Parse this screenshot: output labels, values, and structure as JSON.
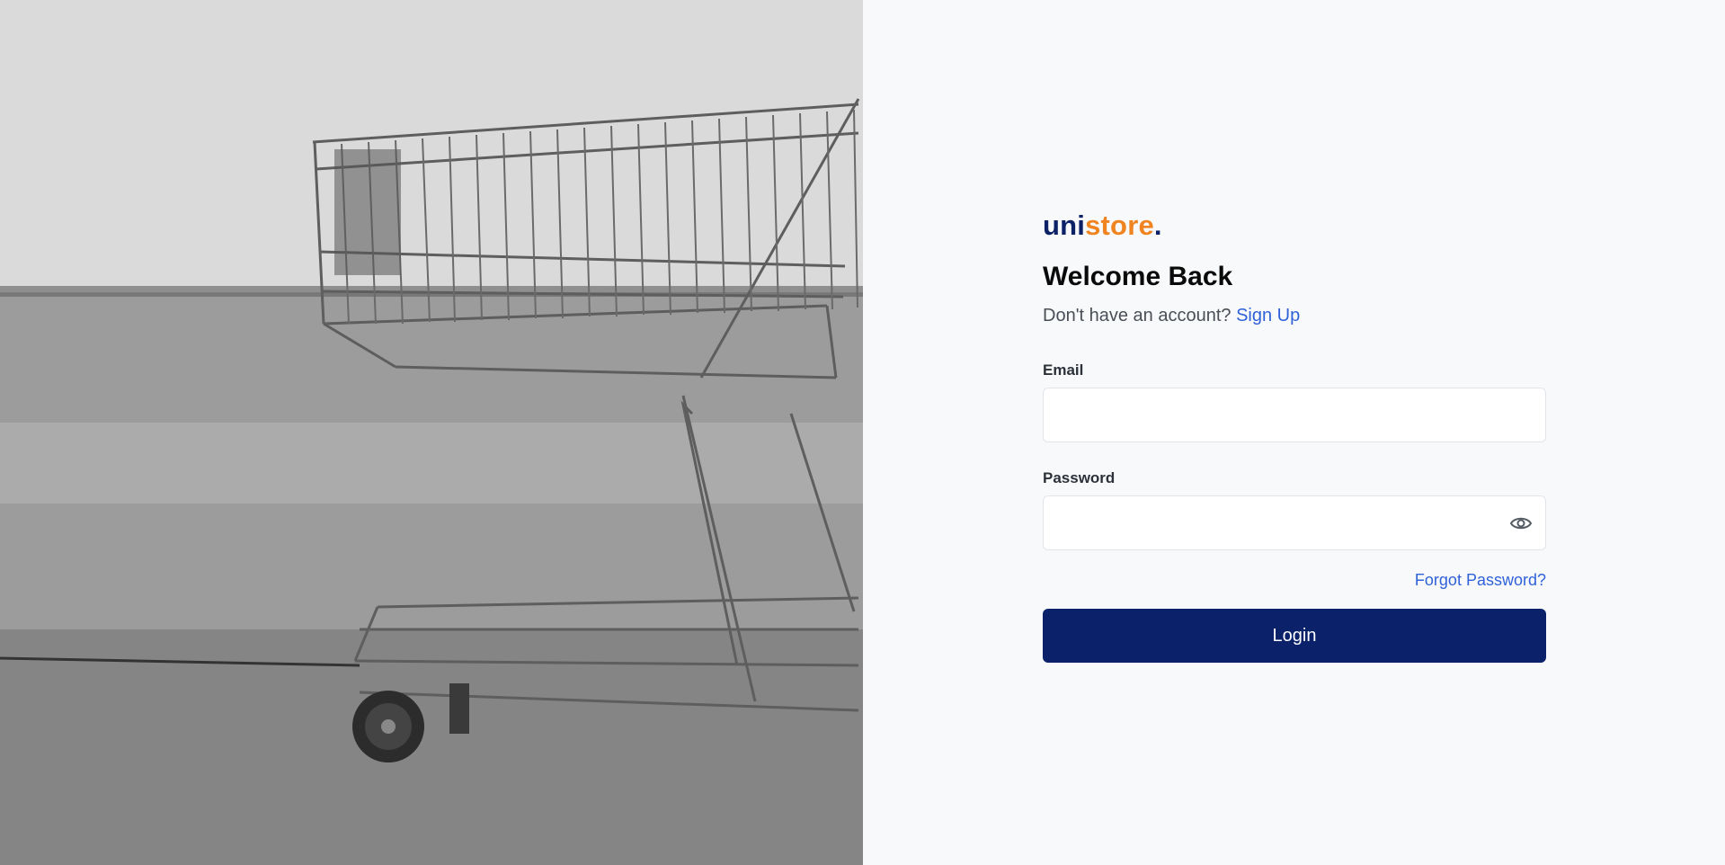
{
  "hero": {
    "image_alt": "Shopping cart"
  },
  "brand": {
    "part1": "uni",
    "part2": "store",
    "part3": ".",
    "color_primary": "#0c2166",
    "color_accent": "#f08421"
  },
  "header": {
    "title": "Welcome Back",
    "prompt": "Don't have an account?",
    "signup_link": "Sign Up"
  },
  "form": {
    "email_label": "Email",
    "email_value": "",
    "password_label": "Password",
    "password_value": "",
    "password_toggle_icon": "eye-icon",
    "forgot_link": "Forgot Password?",
    "login_button": "Login",
    "button_color": "#0b226b",
    "link_color": "#2f62d9"
  }
}
